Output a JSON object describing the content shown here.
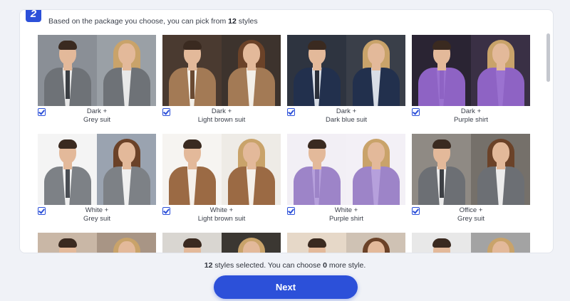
{
  "step_number": "2",
  "intro": {
    "prefix": "Based on the package you choose, you can pick from ",
    "count": "12",
    "suffix": " styles"
  },
  "styles": [
    {
      "line1": "Dark +",
      "line2": "Grey suit",
      "checked": true,
      "bg": "#8a8f96",
      "bg2": "#9aa0a6",
      "suit": "#6e7277",
      "tie": "#3b3f44",
      "shirt": "#e8e8e8"
    },
    {
      "line1": "Dark +",
      "line2": "Light brown suit",
      "checked": true,
      "bg": "#4a3a30",
      "bg2": "#3d332d",
      "suit": "#a37a55",
      "tie": "#6a4a32",
      "shirt": "#f3efe8"
    },
    {
      "line1": "Dark +",
      "line2": "Dark blue suit",
      "checked": true,
      "bg": "#2e3440",
      "bg2": "#3a3f49",
      "suit": "#22304d",
      "tie": "#2a2f3a",
      "shirt": "#d8dde6"
    },
    {
      "line1": "Dark +",
      "line2": "Purple shirt",
      "checked": true,
      "bg": "#2a2433",
      "bg2": "#3a3045",
      "suit": "#8e63c4",
      "tie": "#8e63c4",
      "shirt": "#9b72d0"
    },
    {
      "line1": "White +",
      "line2": "Grey suit",
      "checked": true,
      "bg": "#f4f4f4",
      "bg2": "#9aa3b0",
      "suit": "#7d8186",
      "tie": "#4a4e54",
      "shirt": "#f0f0f0"
    },
    {
      "line1": "White +",
      "line2": "Light brown suit",
      "checked": true,
      "bg": "#f6f4f1",
      "bg2": "#eeebe6",
      "suit": "#9b6a44",
      "tie": "#f5f0ea",
      "shirt": "#f5f0ea"
    },
    {
      "line1": "White +",
      "line2": "Purple shirt",
      "checked": true,
      "bg": "#f2eff5",
      "bg2": "#f3f0f6",
      "suit": "#9d84c8",
      "tie": "#9d84c8",
      "shirt": "#b6a0dc"
    },
    {
      "line1": "Office +",
      "line2": "Grey suit",
      "checked": true,
      "bg": "#8f8a84",
      "bg2": "#75706a",
      "suit": "#6c6f74",
      "tie": "#3d4045",
      "shirt": "#ececec"
    },
    {
      "line1": "",
      "line2": "",
      "checked": false,
      "bg": "#c9b7a6",
      "bg2": "#a89585",
      "suit": "#6a5a4c",
      "tie": "#3a2f27",
      "shirt": "#eee"
    },
    {
      "line1": "",
      "line2": "",
      "checked": false,
      "bg": "#d9d6d1",
      "bg2": "#3b3732",
      "suit": "#6a5a4c",
      "tie": "#3a2f27",
      "shirt": "#eee"
    },
    {
      "line1": "",
      "line2": "",
      "checked": false,
      "bg": "#e6d8c8",
      "bg2": "#cfc2b4",
      "suit": "#6a5a4c",
      "tie": "#3a2f27",
      "shirt": "#eee"
    },
    {
      "line1": "",
      "line2": "",
      "checked": false,
      "bg": "#e8e8e8",
      "bg2": "#a3a3a3",
      "suit": "#6a5a4c",
      "tie": "#3a2f27",
      "shirt": "#eee"
    }
  ],
  "status": {
    "selected_count": "12",
    "middle": " styles selected. You can choose ",
    "remaining": "0",
    "suffix": " more style."
  },
  "next_label": "Next",
  "colors": {
    "accent": "#2c50d9",
    "skin_light": "#e3b99a",
    "hair_blonde": "#c9a36a",
    "hair_brown": "#6b4228"
  }
}
